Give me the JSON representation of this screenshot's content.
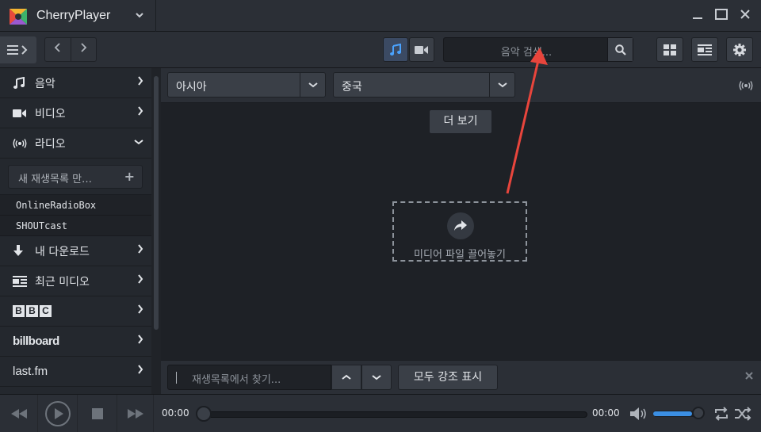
{
  "app": {
    "title": "CherryPlayer"
  },
  "toolbar": {
    "search_placeholder": "음악 검색..."
  },
  "sidebar": {
    "items": [
      {
        "label": "음악",
        "icon": "music-note-icon"
      },
      {
        "label": "비디오",
        "icon": "video-camera-icon"
      },
      {
        "label": "라디오",
        "icon": "radio-broadcast-icon"
      }
    ],
    "new_playlist": "새 재생목록 만…",
    "radio_sources": [
      "OnlineRadioBox",
      "SHOUTcast"
    ],
    "items2": [
      {
        "label": "내 다운로드",
        "icon": "download-arrow-icon"
      },
      {
        "label": "최근 미디오",
        "icon": "recent-media-icon"
      }
    ],
    "brands": [
      "BBC",
      "billboard",
      "last.fm"
    ]
  },
  "filters": {
    "region": "아시아",
    "country": "중국"
  },
  "content": {
    "more_label": "더 보기",
    "drop_label": "미디어 파일 끌어놓기"
  },
  "findbar": {
    "placeholder": "재생목록에서 찾기...",
    "highlight_label": "모두 강조 표시"
  },
  "player": {
    "time_current": "00:00",
    "time_total": "00:00",
    "volume": 0.85
  },
  "colors": {
    "accent": "#3b8fe3",
    "annotation_arrow": "#e8453c"
  }
}
